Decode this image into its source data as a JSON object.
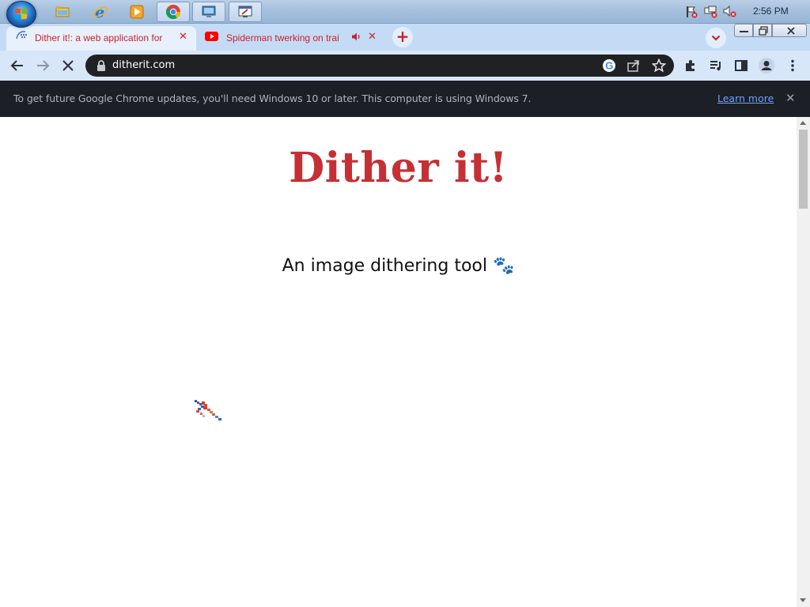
{
  "taskbar": {
    "clock": "2:56 PM",
    "apps": [
      {
        "icon": "file-explorer-icon"
      },
      {
        "icon": "internet-explorer-icon"
      },
      {
        "icon": "media-player-icon"
      },
      {
        "icon": "chrome-icon"
      },
      {
        "icon": "remote-desktop-icon"
      },
      {
        "icon": "paint-icon"
      }
    ],
    "tray_icons": [
      "action-center-icon",
      "network-icon",
      "volume-muted-icon"
    ]
  },
  "tabs": [
    {
      "title": "Dither it!: a web application for",
      "favicon": "ditherit-favicon",
      "active": true
    },
    {
      "title": "Spiderman twerking on trai",
      "favicon": "youtube-icon",
      "audio": true,
      "active": false
    }
  ],
  "toolbar": {
    "url": "ditherit.com",
    "loading": true
  },
  "infobar": {
    "message": "To get future Google Chrome updates, you'll need Windows 10 or later. This computer is using Windows 7.",
    "link": "Learn more"
  },
  "page": {
    "heading": "Dither it!",
    "subtitle": "An image dithering tool 🐾"
  },
  "colors": {
    "heading": "#c43034",
    "tab_text": "#cc1f2b",
    "infobar_bg": "#1c1f26",
    "omnibox_bg": "#202124"
  }
}
